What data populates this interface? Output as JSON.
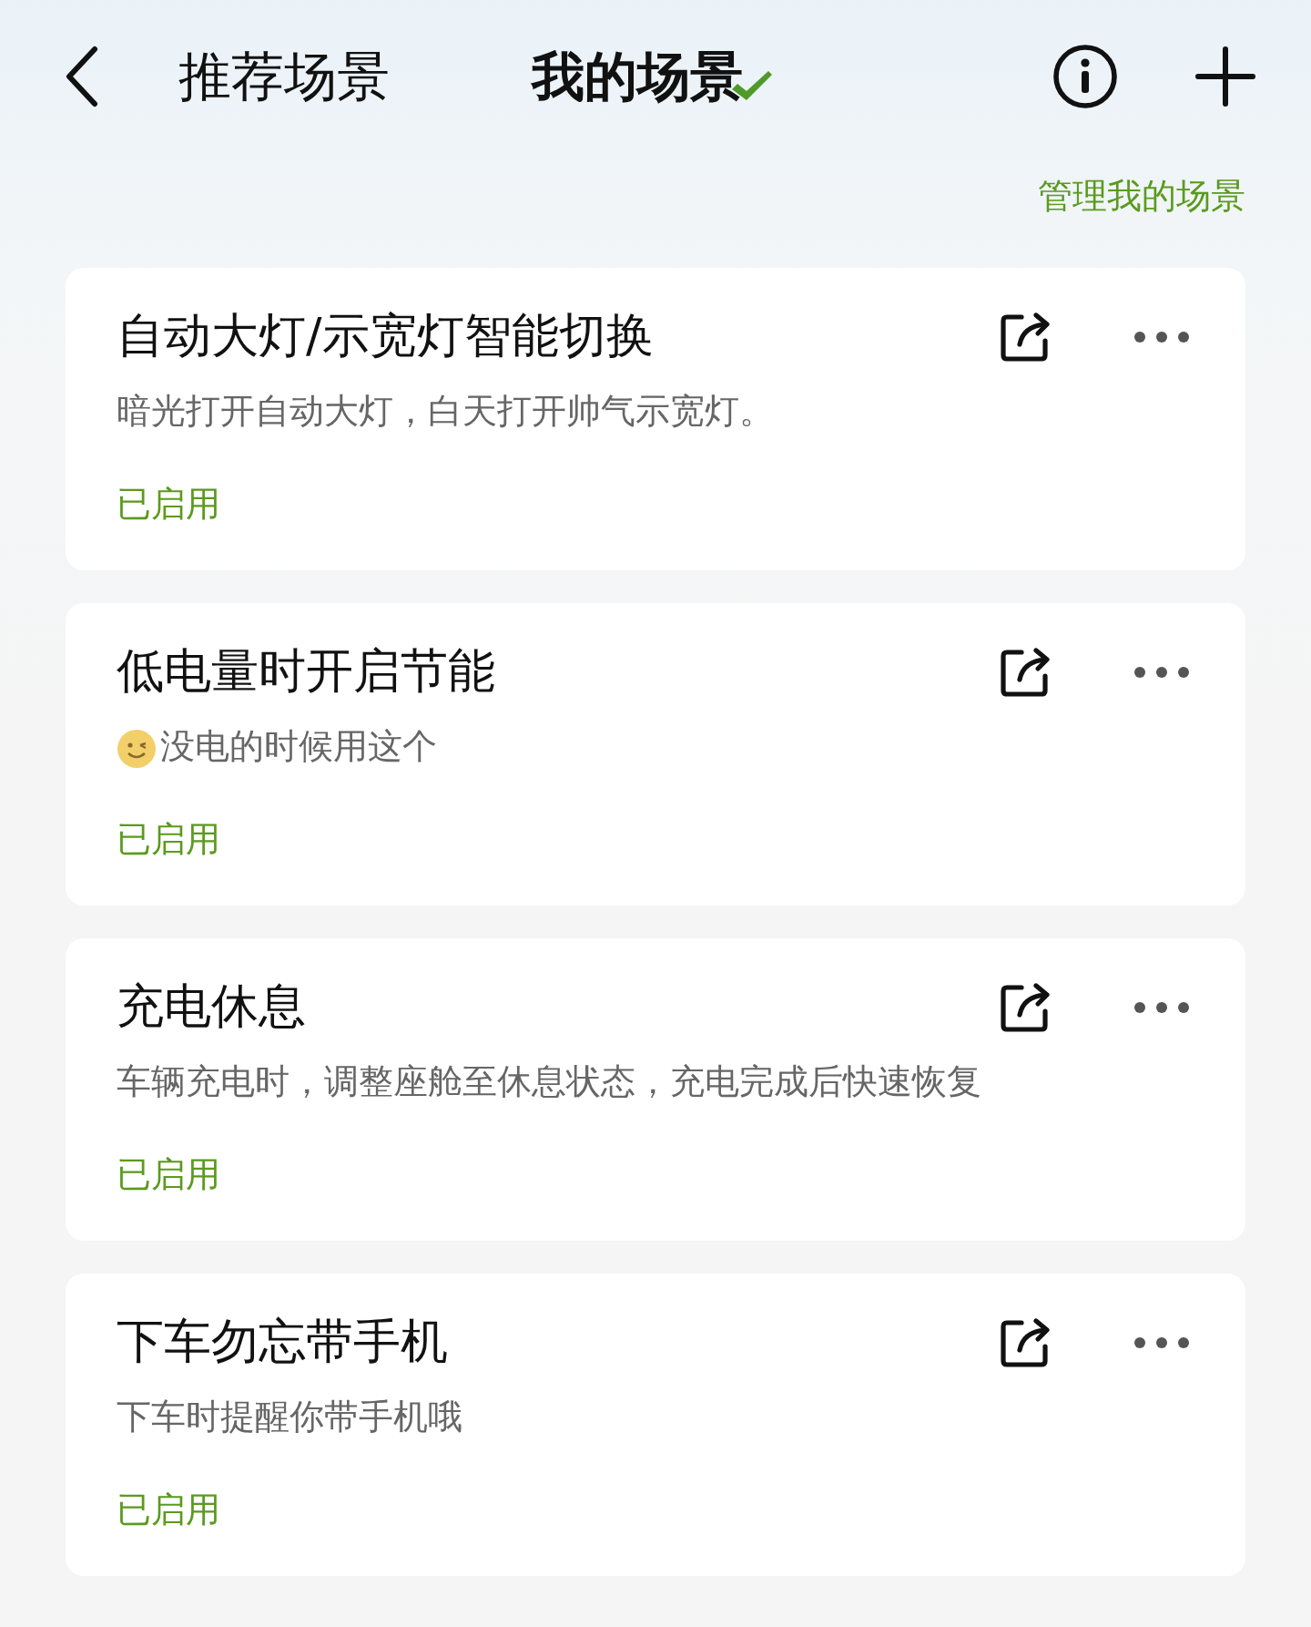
{
  "tabs": [
    {
      "label": "推荐场景",
      "selected": false
    },
    {
      "label": "我的场景",
      "selected": true
    }
  ],
  "manage_link": "管理我的场景",
  "scenes": [
    {
      "title": "自动大灯/示宽灯智能切换",
      "description": "暗光打开自动大灯，白天打开帅气示宽灯。",
      "status": "已启用"
    },
    {
      "title": "低电量时开启节能",
      "has_emoji": true,
      "description": "没电的时候用这个",
      "status": "已启用"
    },
    {
      "title": "充电休息",
      "description": "车辆充电时，调整座舱至休息状态，充电完成后快速恢复",
      "status": "已启用"
    },
    {
      "title": "下车勿忘带手机",
      "description": "下车时提醒你带手机哦",
      "status": "已启用"
    }
  ]
}
